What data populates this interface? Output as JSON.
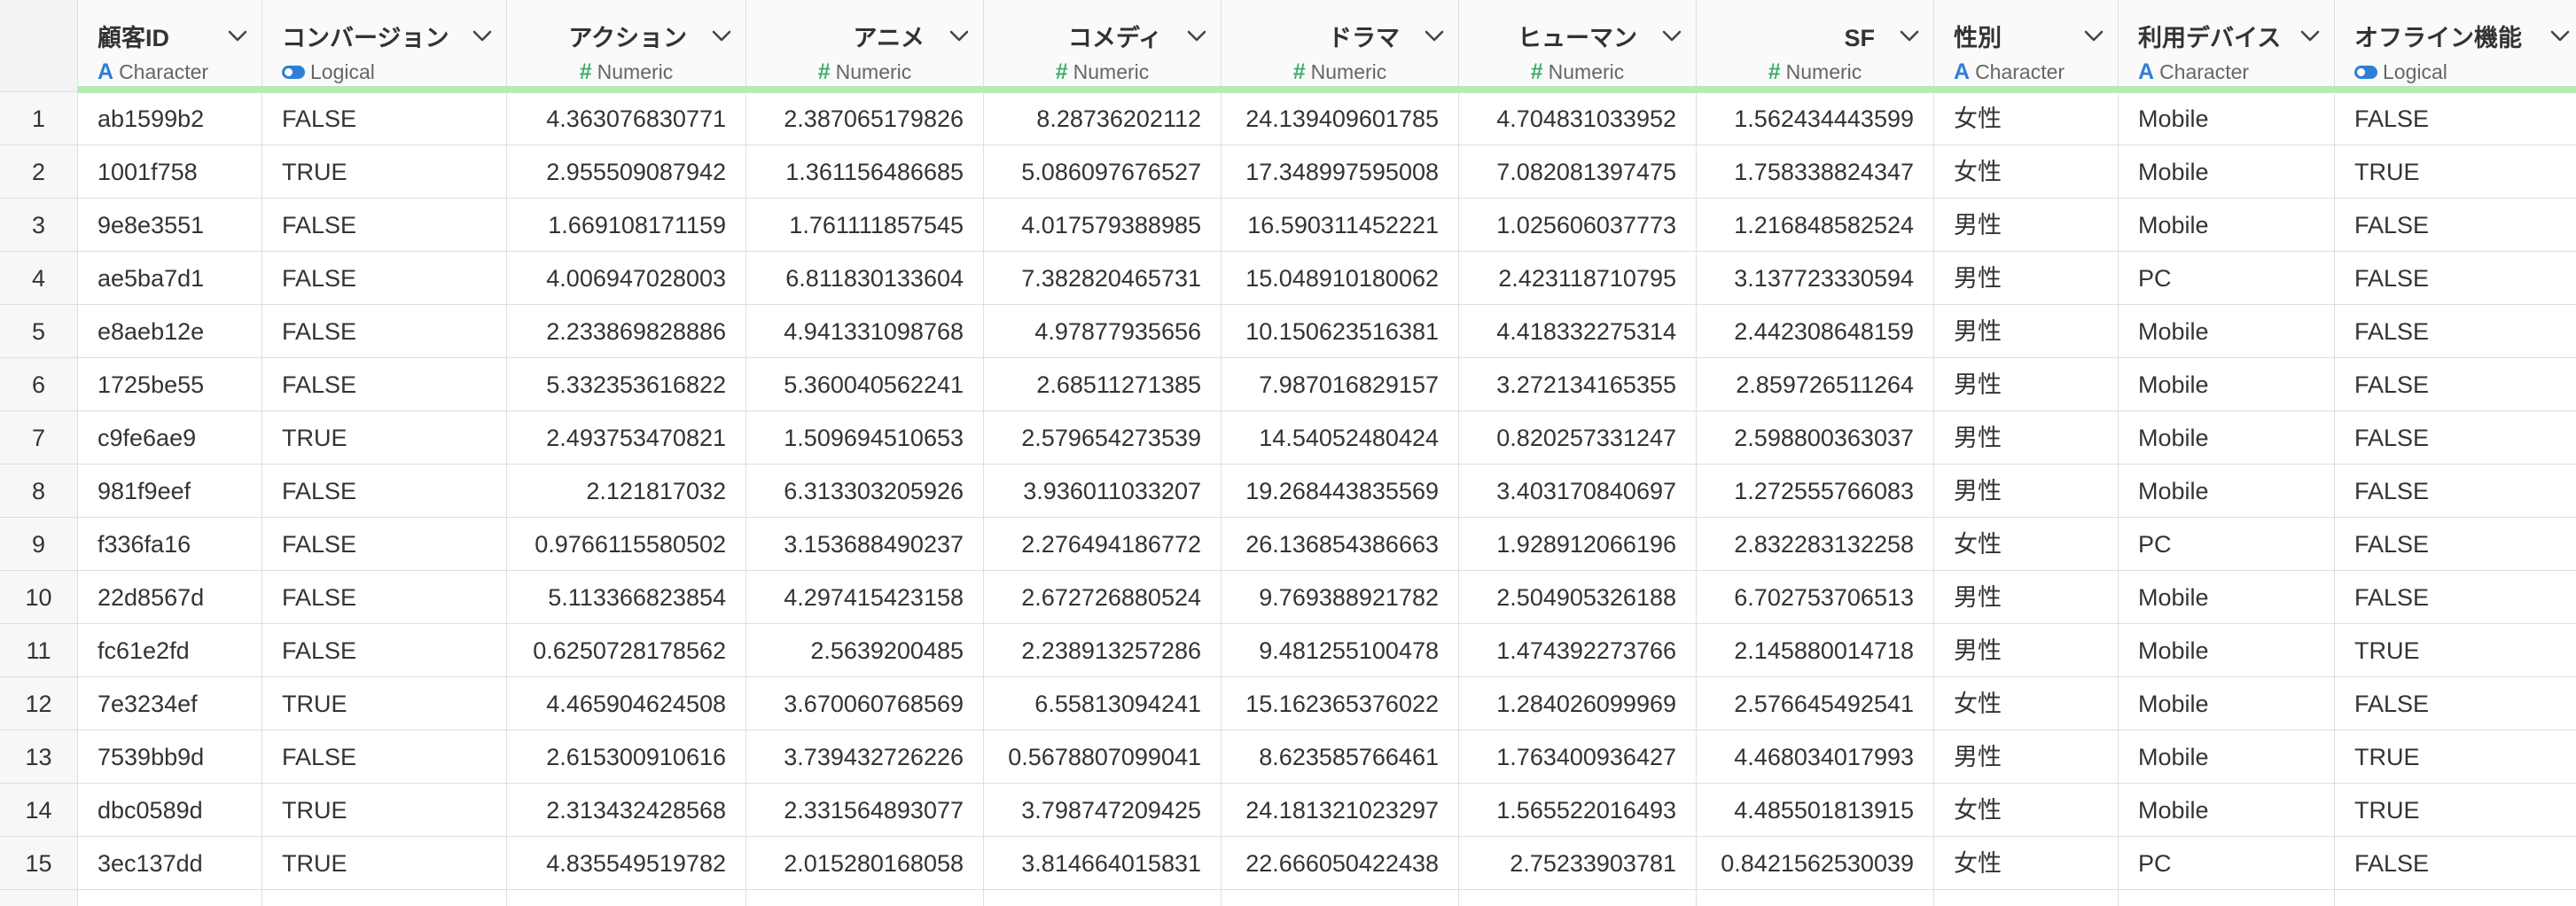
{
  "columns": [
    {
      "key": "id",
      "name": "顧客ID",
      "type": "Character",
      "type_icon": "character-icon",
      "align": "left"
    },
    {
      "key": "conv",
      "name": "コンバージョン",
      "type": "Logical",
      "type_icon": "logical-icon",
      "align": "left"
    },
    {
      "key": "action",
      "name": "アクション",
      "type": "Numeric",
      "type_icon": "numeric-icon",
      "align": "right"
    },
    {
      "key": "anime",
      "name": "アニメ",
      "type": "Numeric",
      "type_icon": "numeric-icon",
      "align": "right"
    },
    {
      "key": "comedy",
      "name": "コメディ",
      "type": "Numeric",
      "type_icon": "numeric-icon",
      "align": "right"
    },
    {
      "key": "drama",
      "name": "ドラマ",
      "type": "Numeric",
      "type_icon": "numeric-icon",
      "align": "right"
    },
    {
      "key": "human",
      "name": "ヒューマン",
      "type": "Numeric",
      "type_icon": "numeric-icon",
      "align": "right"
    },
    {
      "key": "sf",
      "name": "SF",
      "type": "Numeric",
      "type_icon": "numeric-icon",
      "align": "right"
    },
    {
      "key": "gender",
      "name": "性別",
      "type": "Character",
      "type_icon": "character-icon",
      "align": "left"
    },
    {
      "key": "device",
      "name": "利用デバイス",
      "type": "Character",
      "type_icon": "character-icon",
      "align": "left"
    },
    {
      "key": "offline",
      "name": "オフライン機能",
      "type": "Logical",
      "type_icon": "logical-icon",
      "align": "left"
    }
  ],
  "rows": [
    {
      "index": "1",
      "cells": [
        "ab1599b2",
        "FALSE",
        "4.363076830771",
        "2.387065179826",
        "8.28736202112",
        "24.139409601785",
        "4.704831033952",
        "1.562434443599",
        "女性",
        "Mobile",
        "FALSE"
      ]
    },
    {
      "index": "2",
      "cells": [
        "1001f758",
        "TRUE",
        "2.955509087942",
        "1.361156486685",
        "5.086097676527",
        "17.348997595008",
        "7.082081397475",
        "1.758338824347",
        "女性",
        "Mobile",
        "TRUE"
      ]
    },
    {
      "index": "3",
      "cells": [
        "9e8e3551",
        "FALSE",
        "1.669108171159",
        "1.761111857545",
        "4.017579388985",
        "16.590311452221",
        "1.025606037773",
        "1.216848582524",
        "男性",
        "Mobile",
        "FALSE"
      ]
    },
    {
      "index": "4",
      "cells": [
        "ae5ba7d1",
        "FALSE",
        "4.006947028003",
        "6.811830133604",
        "7.382820465731",
        "15.048910180062",
        "2.423118710795",
        "3.137723330594",
        "男性",
        "PC",
        "FALSE"
      ]
    },
    {
      "index": "5",
      "cells": [
        "e8aeb12e",
        "FALSE",
        "2.233869828886",
        "4.941331098768",
        "4.97877935656",
        "10.150623516381",
        "4.418332275314",
        "2.442308648159",
        "男性",
        "Mobile",
        "FALSE"
      ]
    },
    {
      "index": "6",
      "cells": [
        "1725be55",
        "FALSE",
        "5.332353616822",
        "5.360040562241",
        "2.68511271385",
        "7.987016829157",
        "3.272134165355",
        "2.859726511264",
        "男性",
        "Mobile",
        "FALSE"
      ]
    },
    {
      "index": "7",
      "cells": [
        "c9fe6ae9",
        "TRUE",
        "2.493753470821",
        "1.509694510653",
        "2.579654273539",
        "14.54052480424",
        "0.820257331247",
        "2.598800363037",
        "男性",
        "Mobile",
        "FALSE"
      ]
    },
    {
      "index": "8",
      "cells": [
        "981f9eef",
        "FALSE",
        "2.121817032",
        "6.313303205926",
        "3.936011033207",
        "19.268443835569",
        "3.403170840697",
        "1.272555766083",
        "男性",
        "Mobile",
        "FALSE"
      ]
    },
    {
      "index": "9",
      "cells": [
        "f336fa16",
        "FALSE",
        "0.9766115580502",
        "3.153688490237",
        "2.276494186772",
        "26.136854386663",
        "1.928912066196",
        "2.832283132258",
        "女性",
        "PC",
        "FALSE"
      ]
    },
    {
      "index": "10",
      "cells": [
        "22d8567d",
        "FALSE",
        "5.113366823854",
        "4.297415423158",
        "2.672726880524",
        "9.769388921782",
        "2.504905326188",
        "6.702753706513",
        "男性",
        "Mobile",
        "FALSE"
      ]
    },
    {
      "index": "11",
      "cells": [
        "fc61e2fd",
        "FALSE",
        "0.6250728178562",
        "2.5639200485",
        "2.238913257286",
        "9.481255100478",
        "1.474392273766",
        "2.145880014718",
        "男性",
        "Mobile",
        "TRUE"
      ]
    },
    {
      "index": "12",
      "cells": [
        "7e3234ef",
        "TRUE",
        "4.465904624508",
        "3.670060768569",
        "6.55813094241",
        "15.162365376022",
        "1.284026099969",
        "2.576645492541",
        "女性",
        "Mobile",
        "FALSE"
      ]
    },
    {
      "index": "13",
      "cells": [
        "7539bb9d",
        "FALSE",
        "2.615300910616",
        "3.739432726226",
        "0.5678807099041",
        "8.623585766461",
        "1.763400936427",
        "4.468034017993",
        "男性",
        "Mobile",
        "TRUE"
      ]
    },
    {
      "index": "14",
      "cells": [
        "dbc0589d",
        "TRUE",
        "2.313432428568",
        "2.331564893077",
        "3.798747209425",
        "24.181321023297",
        "1.565522016493",
        "4.485501813915",
        "女性",
        "Mobile",
        "TRUE"
      ]
    },
    {
      "index": "15",
      "cells": [
        "3ec137dd",
        "TRUE",
        "4.835549519782",
        "2.015280168058",
        "3.814664015831",
        "22.666050422438",
        "2.75233903781",
        "0.8421562530039",
        "女性",
        "PC",
        "FALSE"
      ]
    }
  ],
  "colors": {
    "header_bg": "#fafafa",
    "index_bg": "#f7f7f7",
    "grid_line": "#dedede",
    "quality_bar": "#b6ebb5",
    "character_icon": "#2f7fd6",
    "numeric_icon": "#3dad6a",
    "logical_icon": "#2f7fd6"
  }
}
